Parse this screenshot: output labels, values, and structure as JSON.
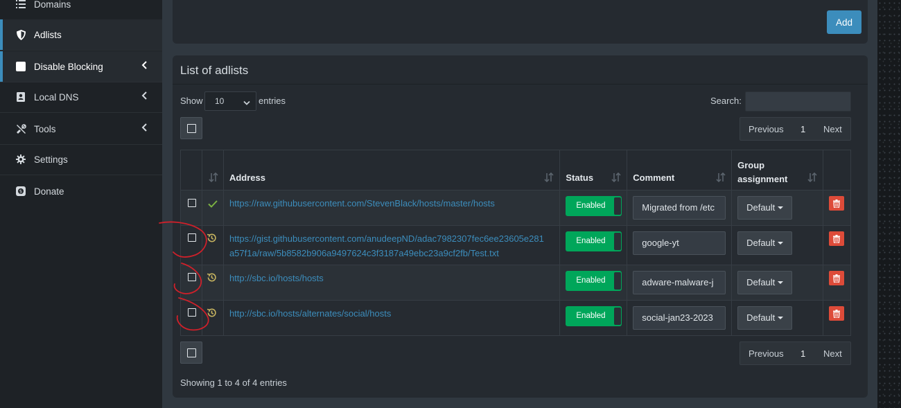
{
  "sidebar": {
    "items": [
      {
        "label": "Domains",
        "icon": "list-icon"
      },
      {
        "label": "Adlists",
        "icon": "shield-icon",
        "active": true
      },
      {
        "label": "Disable Blocking",
        "icon": "stop-icon",
        "chevron": true
      },
      {
        "label": "Local DNS",
        "icon": "address-book-icon",
        "chevron": true
      },
      {
        "label": "Tools",
        "icon": "tools-icon",
        "chevron": true
      },
      {
        "label": "Settings",
        "icon": "gear-icon"
      },
      {
        "label": "Donate",
        "icon": "donate-icon"
      }
    ]
  },
  "top_card": {
    "add_label": "Add"
  },
  "adlists": {
    "title": "List of adlists",
    "show_label": "Show",
    "page_length": "10",
    "entries_label": "entries",
    "search_label": "Search:",
    "pager": {
      "previous": "Previous",
      "page": "1",
      "next": "Next"
    },
    "columns": {
      "address": "Address",
      "status": "Status",
      "comment": "Comment",
      "group": "Group assignment"
    },
    "rows": [
      {
        "address": "https://raw.githubusercontent.com/StevenBlack/hosts/master/hosts",
        "state_icon": "check-icon",
        "status": "Enabled",
        "comment": "Migrated from /etc",
        "group": "Default"
      },
      {
        "address_line1": "https://gist.githubusercontent.com/anudeepND/adac7982307fec6ee23605e281",
        "address_line2": "a57f1a/raw/5b8582b906a9497624c3f3187a49ebc23a9cf2fb/Test.txt",
        "state_icon": "history-icon",
        "status": "Enabled",
        "comment": "google-yt",
        "group": "Default"
      },
      {
        "address": "http://sbc.io/hosts/hosts",
        "state_icon": "history-icon",
        "status": "Enabled",
        "comment": "adware-malware-j",
        "group": "Default"
      },
      {
        "address": "http://sbc.io/hosts/alternates/social/hosts",
        "state_icon": "history-icon",
        "status": "Enabled",
        "comment": "social-jan23-2023",
        "group": "Default"
      }
    ],
    "showing": "Showing 1 to 4 of 4 entries"
  },
  "colors": {
    "accent": "#3c8dbc",
    "enabled": "#00a65a",
    "danger": "#dd4b39",
    "check": "#7cb342",
    "history": "#c8b560",
    "annotation": "#d0202a"
  }
}
